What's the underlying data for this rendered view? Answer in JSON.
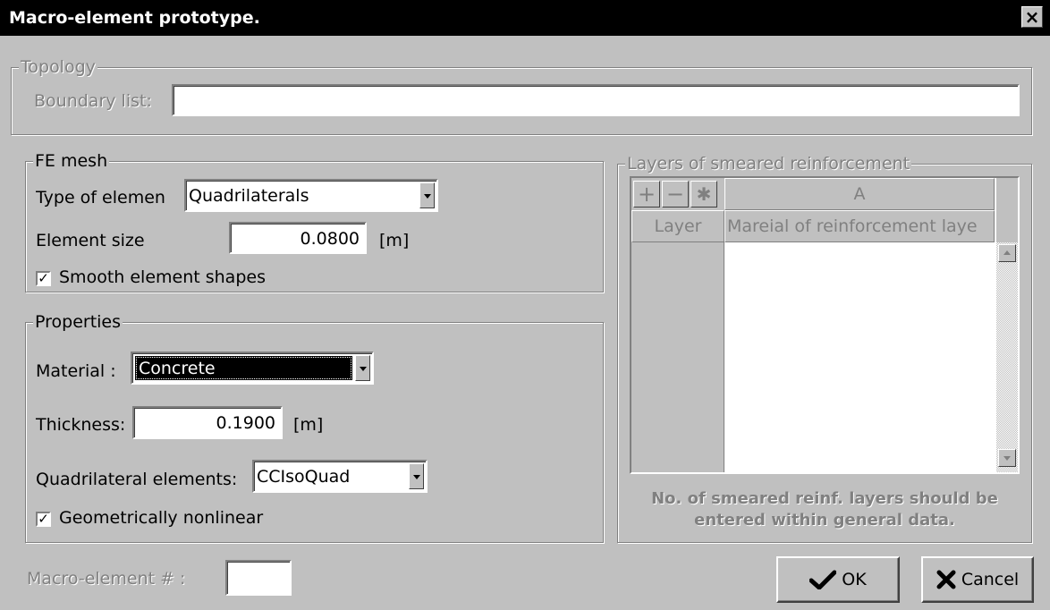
{
  "window": {
    "title": "Macro-element prototype.",
    "close_glyph": "×"
  },
  "topology": {
    "legend": "Topology",
    "boundary_label": "Boundary list:",
    "boundary_value": ""
  },
  "fe_mesh": {
    "legend": "FE mesh",
    "type_label": "Type of elemen",
    "type_value": "Quadrilaterals",
    "size_label": "Element size",
    "size_value": "0.0800",
    "size_unit": "[m]",
    "smooth_label": "Smooth element shapes",
    "smooth_checked": true
  },
  "properties": {
    "legend": "Properties",
    "material_label": "Material :",
    "material_value": "Concrete",
    "thickness_label": "Thickness:",
    "thickness_value": "0.1900",
    "thickness_unit": "[m]",
    "quad_label": "Quadrilateral elements:",
    "quad_value": "CCIsoQuad",
    "nonlinear_label": "Geometrically nonlinear",
    "nonlinear_checked": true
  },
  "layers": {
    "legend": "Layers of smeared reinforcement",
    "tool_add": "+",
    "tool_remove": "−",
    "tool_star": "✱",
    "col_header": "A",
    "row_header": "Layer",
    "col_title": "Mareial of reinforcement laye",
    "note": "No. of smeared reinf. layers should be entered within general data."
  },
  "macro": {
    "label": "Macro-element # :",
    "value": ""
  },
  "buttons": {
    "ok_label": "OK",
    "ok_icon": "checkmark-icon",
    "cancel_label": "Cancel",
    "cancel_icon": "x-icon"
  },
  "colors": {
    "titlebar": "#000000",
    "face": "#c0c0c0",
    "selection": "#000000"
  }
}
